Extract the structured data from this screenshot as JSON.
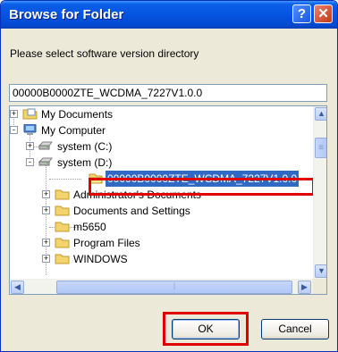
{
  "window": {
    "title": "Browse for Folder",
    "help_glyph": "?",
    "close_glyph": "✕"
  },
  "prompt": "Please select software version directory",
  "path_value": "00000B0000ZTE_WCDMA_7227V1.0.0",
  "tree": {
    "items": [
      {
        "label": "My Documents",
        "icon": "folder-documents-icon",
        "expander": "+"
      },
      {
        "label": "My Computer",
        "icon": "computer-icon",
        "expander": "-"
      },
      {
        "label": "system (C:)",
        "icon": "drive-icon",
        "expander": "+"
      },
      {
        "label": "system (D:)",
        "icon": "drive-icon",
        "expander": "-"
      },
      {
        "label": "00000B0000ZTE_WCDMA_7227V1.0.0",
        "icon": "folder-icon",
        "selected": true
      },
      {
        "label": "Administrator's Documents",
        "icon": "folder-icon",
        "expander": "+"
      },
      {
        "label": "Documents and Settings",
        "icon": "folder-icon",
        "expander": "+"
      },
      {
        "label": "m5650",
        "icon": "folder-icon"
      },
      {
        "label": "Program Files",
        "icon": "folder-icon",
        "expander": "+"
      },
      {
        "label": "WINDOWS",
        "icon": "folder-icon",
        "expander": "+"
      }
    ]
  },
  "scroll_glyphs": {
    "up": "▲",
    "down": "▼",
    "left": "◀",
    "right": "▶",
    "grip_v": "≡",
    "grip_h": "⁞"
  },
  "buttons": {
    "ok": "OK",
    "cancel": "Cancel"
  },
  "colors": {
    "titlebar": "#0554e0",
    "selection": "#316ac5",
    "highlight_box": "#e00000",
    "dialog_bg": "#ece9d8"
  }
}
